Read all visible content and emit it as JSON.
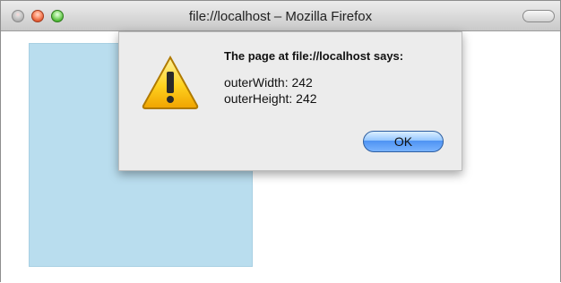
{
  "window": {
    "title": "file://localhost – Mozilla Firefox"
  },
  "dialog": {
    "header": "The page at file://localhost says:",
    "lines": [
      "outerWidth: 242",
      "outerHeight: 242"
    ],
    "ok_label": "OK"
  },
  "icons": {
    "alert": "warning-icon"
  },
  "colors": {
    "content_box": "#b9ddee",
    "dialog_background": "#ececec",
    "ok_button": "#4e93f2"
  }
}
